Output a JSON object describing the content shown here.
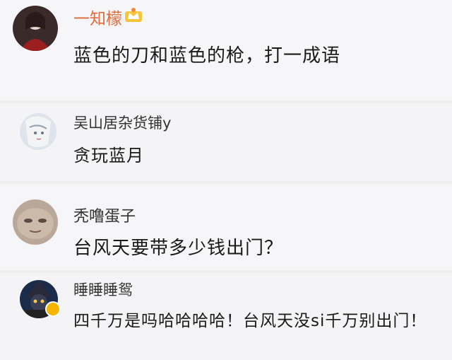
{
  "comments": [
    {
      "user": "一知檬",
      "text": "蓝色的刀和蓝色的枪，打一成语",
      "name_color": "#e06a3a"
    },
    {
      "user": "吴山居杂货铺y",
      "text": "贪玩蓝月"
    },
    {
      "user": "秃噜蛋子",
      "text": "台风天要带多少钱出门？"
    },
    {
      "user": "睡睡睡鸳",
      "text": "四千万是吗哈哈哈哈！台风天没si千万别出门！"
    }
  ]
}
